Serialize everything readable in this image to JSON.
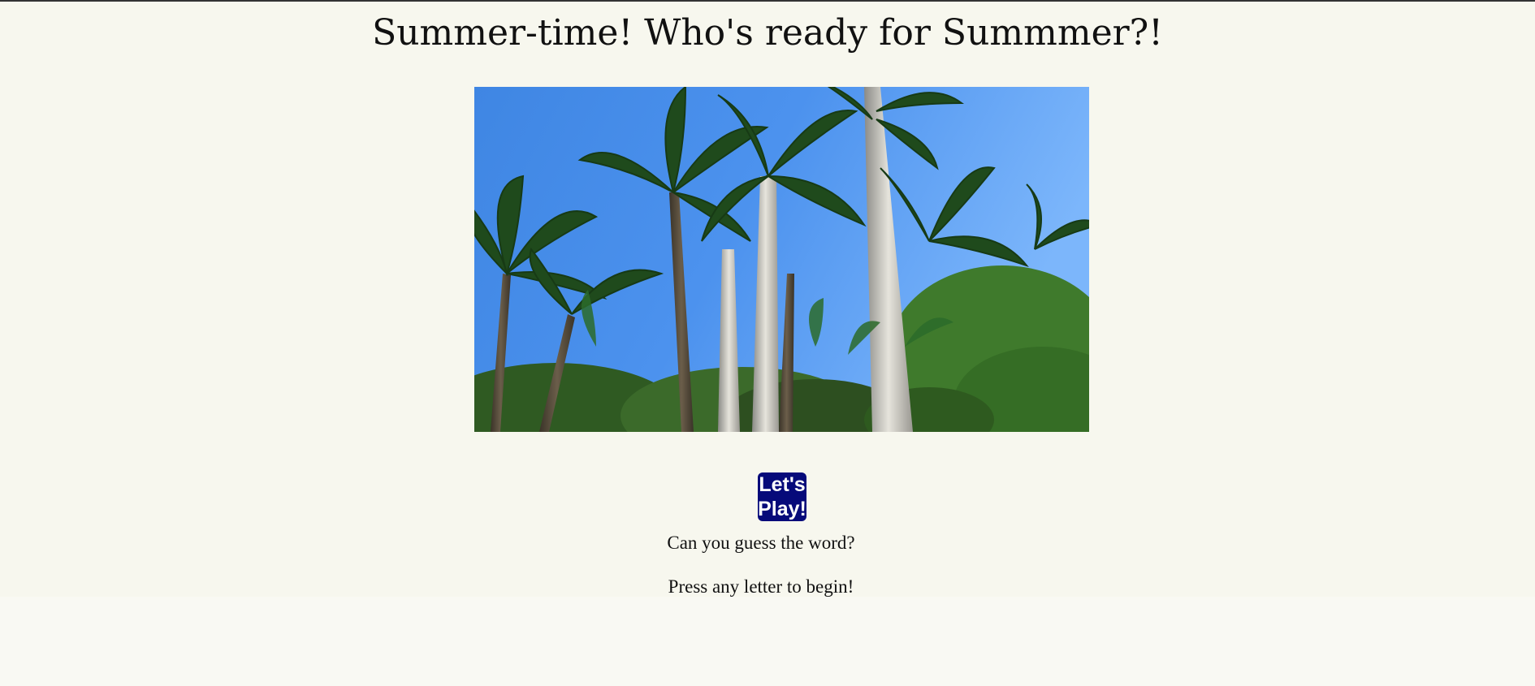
{
  "page": {
    "title": "Summer-time! Who's ready for Summmer?!"
  },
  "hero_image": {
    "description_icon": "palm-trees-image"
  },
  "play_button": {
    "label_line1": "Let's",
    "label_line2": "Play!"
  },
  "instructions": {
    "question": "Can you guess the word?",
    "start_hint": "Press any letter to begin!"
  },
  "colors": {
    "background": "#f7f7ee",
    "button": "#060a7a",
    "sky": "#4a8fe6"
  }
}
